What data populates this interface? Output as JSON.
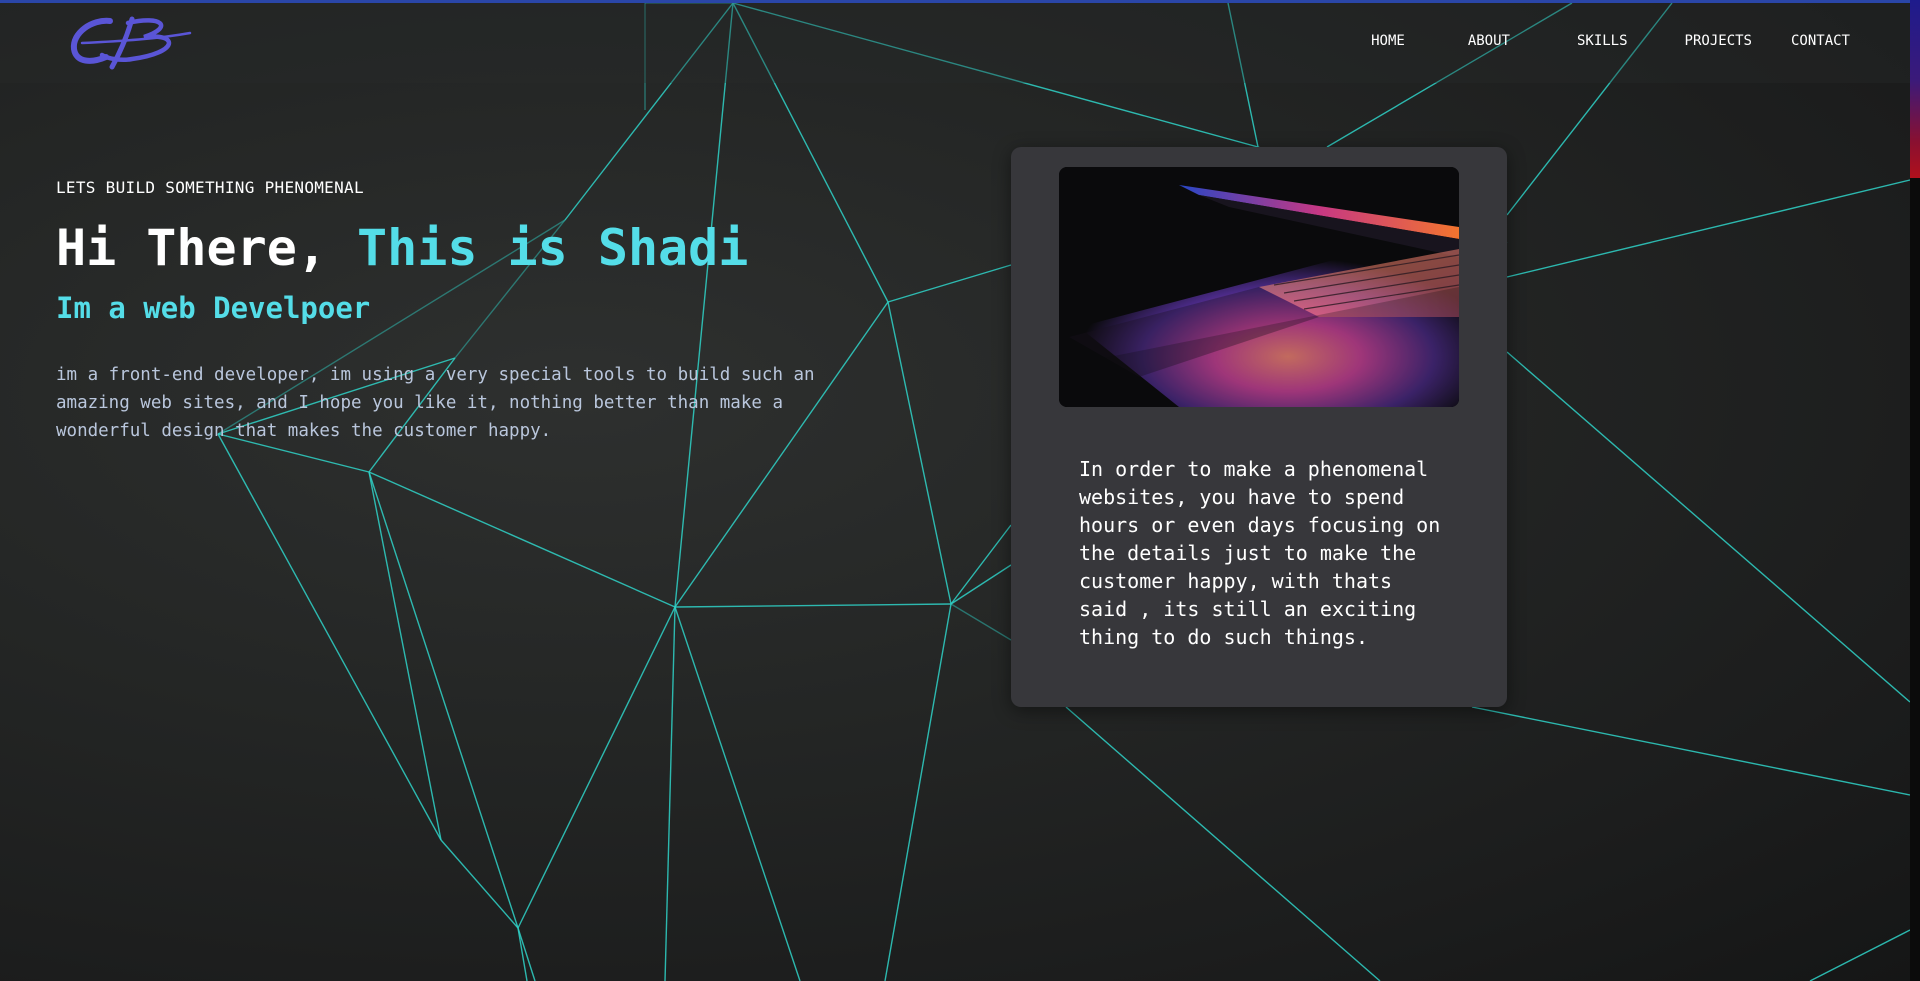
{
  "header": {
    "logo_text": "CB",
    "nav": [
      {
        "label": "HOME"
      },
      {
        "label": "ABOUT"
      },
      {
        "label": "SKILLS"
      },
      {
        "label": "PROJECTS"
      },
      {
        "label": "CONTACT"
      }
    ]
  },
  "hero": {
    "eyebrow": "LETS BUILD SOMETHING PHENOMENAL",
    "title_prefix": "Hi There, ",
    "title_accent": "This is Shadi",
    "subtitle": "Im a web Develpoer",
    "description": "im a front-end developer, im using a very special tools to build such an amazing web sites, and I hope you like it, nothing better than make a wonderful design that makes the customer happy."
  },
  "card": {
    "image_icon": "laptop-photo",
    "text": "In order to make a phenomenal websites, you have to spend hours or even days focusing on the details just to make the customer happy, with thats said , its still an exciting thing to do such things."
  },
  "colors": {
    "accent": "#54dde8",
    "lines": "#2fd3c8",
    "logo": "#5a55d6",
    "card": "#37373b"
  }
}
